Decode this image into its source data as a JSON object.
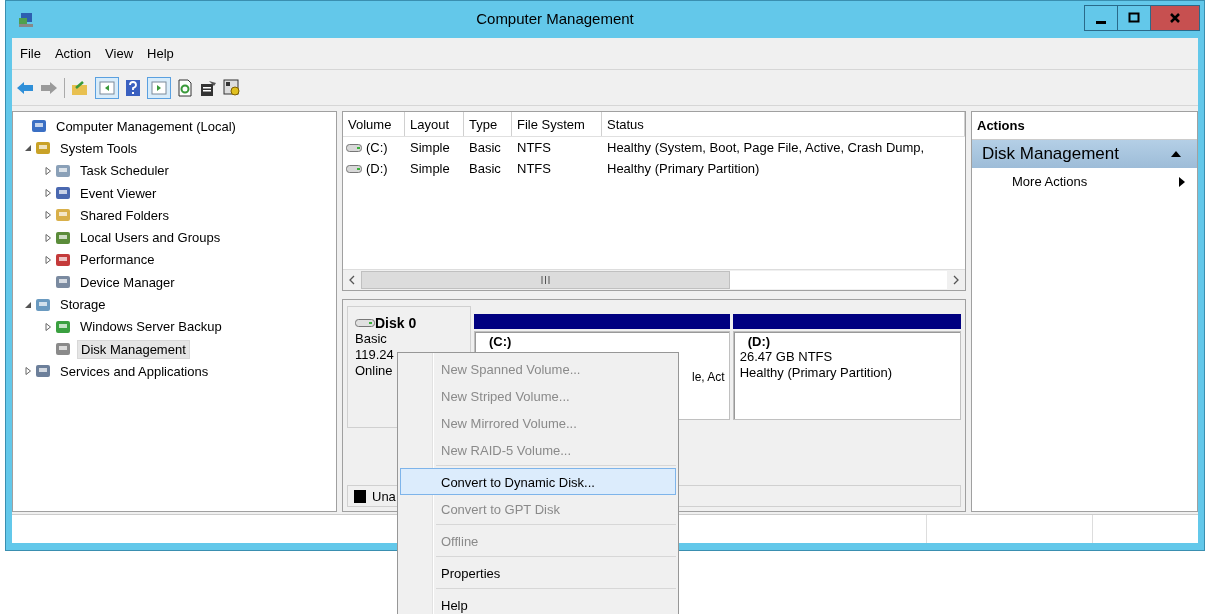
{
  "window": {
    "title": "Computer Management"
  },
  "menu_bar": [
    {
      "label": "File"
    },
    {
      "label": "Action"
    },
    {
      "label": "View"
    },
    {
      "label": "Help"
    }
  ],
  "tree": [
    {
      "label": "Computer Management (Local)",
      "selected": false,
      "children": [
        {
          "label": "System Tools",
          "selected": false,
          "expanded": true,
          "children": [
            {
              "label": "Task Scheduler",
              "selected": false,
              "expanded": false
            },
            {
              "label": "Event Viewer",
              "selected": false,
              "expanded": false
            },
            {
              "label": "Shared Folders",
              "selected": false,
              "expanded": false
            },
            {
              "label": "Local Users and Groups",
              "selected": false,
              "expanded": false
            },
            {
              "label": "Performance",
              "selected": false,
              "expanded": false
            },
            {
              "label": "Device Manager",
              "selected": false
            }
          ]
        },
        {
          "label": "Storage",
          "selected": false,
          "expanded": true,
          "children": [
            {
              "label": "Windows Server Backup",
              "selected": false,
              "expanded": false
            },
            {
              "label": "Disk Management",
              "selected": true
            }
          ]
        },
        {
          "label": "Services and Applications",
          "selected": false,
          "expanded": false
        }
      ]
    }
  ],
  "volume_list": {
    "columns": [
      "Volume",
      "Layout",
      "Type",
      "File System",
      "Status"
    ],
    "rows": [
      {
        "volume": "(C:)",
        "layout": "Simple",
        "type": "Basic",
        "file_system": "NTFS",
        "status": "Healthy (System, Boot, Page File, Active, Crash Dump,"
      },
      {
        "volume": "(D:)",
        "layout": "Simple",
        "type": "Basic",
        "file_system": "NTFS",
        "status": "Healthy (Primary Partition)"
      }
    ]
  },
  "disk_map": {
    "disk": {
      "name": "Disk 0",
      "lines": [
        "Basic",
        "119.24",
        "Online"
      ]
    },
    "partitions": [
      {
        "label": "(C:)",
        "covered": true,
        "lines": [
          "le, Act"
        ]
      },
      {
        "label": "(D:)",
        "covered": false,
        "lines": [
          "26.47 GB NTFS",
          "Healthy (Primary Partition)"
        ]
      }
    ],
    "legend": [
      {
        "label": "Una",
        "color": "#000000"
      }
    ]
  },
  "actions": {
    "title": "Actions",
    "section": "Disk Management",
    "items": [
      {
        "label": "More Actions"
      }
    ]
  },
  "context_menu": [
    {
      "kind": "item",
      "label": "New Spanned Volume...",
      "disabled": true,
      "selected": false
    },
    {
      "kind": "item",
      "label": "New Striped Volume...",
      "disabled": true,
      "selected": false
    },
    {
      "kind": "item",
      "label": "New Mirrored Volume...",
      "disabled": true,
      "selected": false
    },
    {
      "kind": "item",
      "label": "New RAID-5 Volume...",
      "disabled": true,
      "selected": false
    },
    {
      "kind": "separator"
    },
    {
      "kind": "item",
      "label": "Convert to Dynamic Disk...",
      "disabled": false,
      "selected": true
    },
    {
      "kind": "item",
      "label": "Convert to GPT Disk",
      "disabled": true,
      "selected": false
    },
    {
      "kind": "separator"
    },
    {
      "kind": "item",
      "label": "Offline",
      "disabled": true,
      "selected": false
    },
    {
      "kind": "separator"
    },
    {
      "kind": "item",
      "label": "Properties",
      "disabled": false,
      "selected": false
    },
    {
      "kind": "separator"
    },
    {
      "kind": "item",
      "label": "Help",
      "disabled": false,
      "selected": false
    }
  ]
}
